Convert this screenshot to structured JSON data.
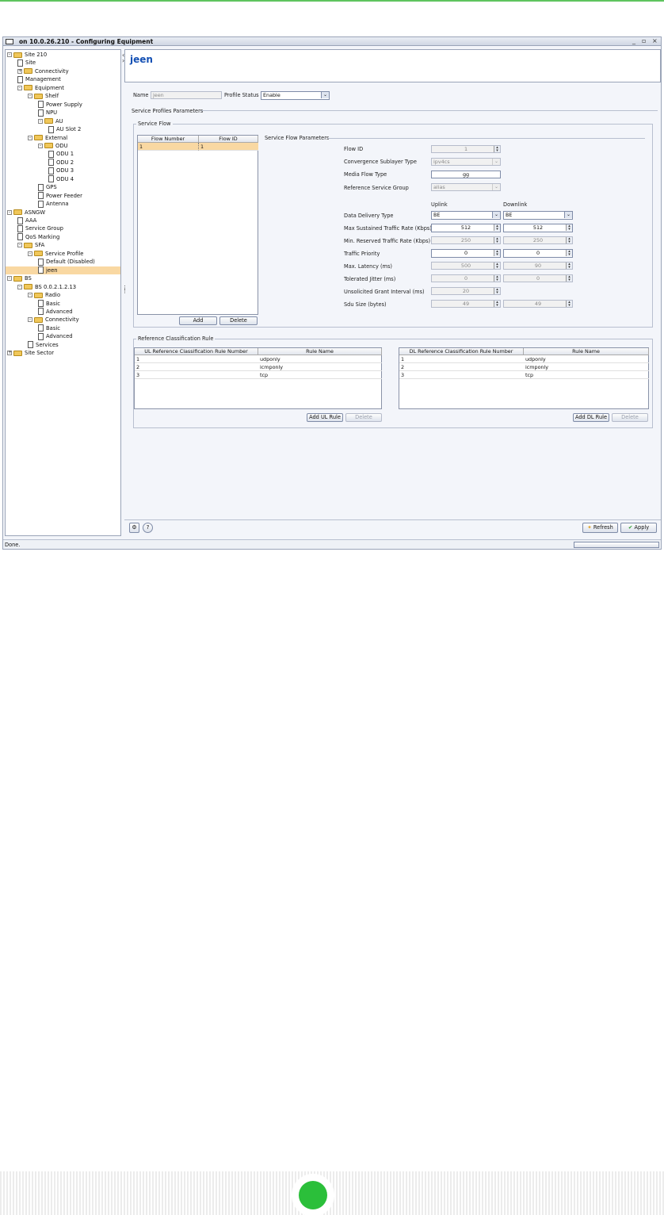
{
  "window": {
    "title": "on 10.0.26.210 - Configuring Equipment",
    "controls": [
      "_",
      "▫",
      "×"
    ]
  },
  "tree": {
    "items": [
      {
        "label": "Site 210",
        "type": "folder"
      },
      {
        "label": "Site",
        "type": "doc"
      },
      {
        "label": "Connectivity",
        "type": "folder"
      },
      {
        "label": "Management",
        "type": "doc"
      },
      {
        "label": "Equipment",
        "type": "folder"
      },
      {
        "label": "Shelf",
        "type": "folder"
      },
      {
        "label": "Power Supply",
        "type": "doc"
      },
      {
        "label": "NPU",
        "type": "doc"
      },
      {
        "label": "AU",
        "type": "folder"
      },
      {
        "label": "AU Slot 2",
        "type": "doc"
      },
      {
        "label": "External",
        "type": "folder"
      },
      {
        "label": "ODU",
        "type": "folder"
      },
      {
        "label": "ODU 1",
        "type": "doc"
      },
      {
        "label": "ODU 2",
        "type": "doc"
      },
      {
        "label": "ODU 3",
        "type": "doc"
      },
      {
        "label": "ODU 4",
        "type": "doc"
      },
      {
        "label": "GPS",
        "type": "doc"
      },
      {
        "label": "Power Feeder",
        "type": "doc"
      },
      {
        "label": "Antenna",
        "type": "doc"
      },
      {
        "label": "ASNGW",
        "type": "folder"
      },
      {
        "label": "AAA",
        "type": "doc"
      },
      {
        "label": "Service Group",
        "type": "doc"
      },
      {
        "label": "QoS Marking",
        "type": "doc"
      },
      {
        "label": "SFA",
        "type": "folder"
      },
      {
        "label": "Service Profile",
        "type": "folder"
      },
      {
        "label": "Default (Disabled)",
        "type": "doc"
      },
      {
        "label": "jeen",
        "type": "doc"
      },
      {
        "label": "BS",
        "type": "folder"
      },
      {
        "label": "BS 0.0.2.1.2.13",
        "type": "folder"
      },
      {
        "label": "Radio",
        "type": "folder"
      },
      {
        "label": "Basic",
        "type": "doc"
      },
      {
        "label": "Advanced",
        "type": "doc"
      },
      {
        "label": "Connectivity",
        "type": "folder"
      },
      {
        "label": "Basic",
        "type": "doc"
      },
      {
        "label": "Advanced",
        "type": "doc"
      },
      {
        "label": "Services",
        "type": "doc"
      },
      {
        "label": "Site Sector",
        "type": "folder"
      }
    ]
  },
  "header": {
    "title": "jeen"
  },
  "form": {
    "name_label": "Name",
    "name_value": "jeen",
    "status_label": "Profile Status",
    "status_value": "Enable",
    "section_title": "Service Profiles Parameters"
  },
  "service_flow": {
    "group_title": "Service Flow",
    "columns": [
      "Flow Number",
      "Flow ID"
    ],
    "rows": [
      [
        "1",
        "1"
      ]
    ],
    "add_label": "Add",
    "delete_label": "Delete"
  },
  "flow_params": {
    "group_title": "Service Flow Parameters",
    "flow_id_label": "Flow ID",
    "flow_id": "1",
    "cs_type_label": "Convergence Sublayer Type",
    "cs_type": "ipv4cs",
    "media_label": "Media Flow Type",
    "media": "gg",
    "rsg_label": "Reference Service Group",
    "rsg": "alias",
    "uplink_label": "Uplink",
    "downlink_label": "Downlink",
    "ddt_label": "Data Delivery Type",
    "ddt_ul": "BE",
    "ddt_dl": "BE",
    "mstr_label": "Max Sustained Traffic Rate (Kbps)",
    "mstr_ul": "512",
    "mstr_dl": "512",
    "mrtr_label": "Min. Reserved Traffic Rate (Kbps)",
    "mrtr_ul": "250",
    "mrtr_dl": "250",
    "tp_label": "Traffic Priority",
    "tp_ul": "0",
    "tp_dl": "0",
    "lat_label": "Max. Latency (ms)",
    "lat_ul": "500",
    "lat_dl": "90",
    "jit_label": "Tolerated Jitter (ms)",
    "jit_ul": "0",
    "jit_dl": "0",
    "ugi_label": "Unsolicited Grant Interval (ms)",
    "ugi_ul": "20",
    "sdu_label": "Sdu Size (bytes)",
    "sdu_ul": "49",
    "sdu_dl": "49"
  },
  "ref_rules": {
    "group_title": "Reference Classification Rule",
    "ul_columns": [
      "UL Reference Classification Rule Number",
      "Rule Name"
    ],
    "dl_columns": [
      "DL Reference Classification Rule Number",
      "Rule Name"
    ],
    "ul_rows": [
      [
        "1",
        "udponly"
      ],
      [
        "2",
        "icmponly"
      ],
      [
        "3",
        "tcp"
      ]
    ],
    "dl_rows": [
      [
        "1",
        "udponly"
      ],
      [
        "2",
        "icmponly"
      ],
      [
        "3",
        "tcp"
      ]
    ],
    "add_ul_label": "Add UL Rule",
    "add_dl_label": "Add DL Rule",
    "delete_label": "Delete"
  },
  "bottom": {
    "refresh_label": "Refresh",
    "apply_label": "Apply"
  },
  "status": {
    "text": "Done."
  },
  "colors": {
    "accent": "#1450b4",
    "selection": "#f9d8a2",
    "footer_dot": "#2bbf3a"
  }
}
